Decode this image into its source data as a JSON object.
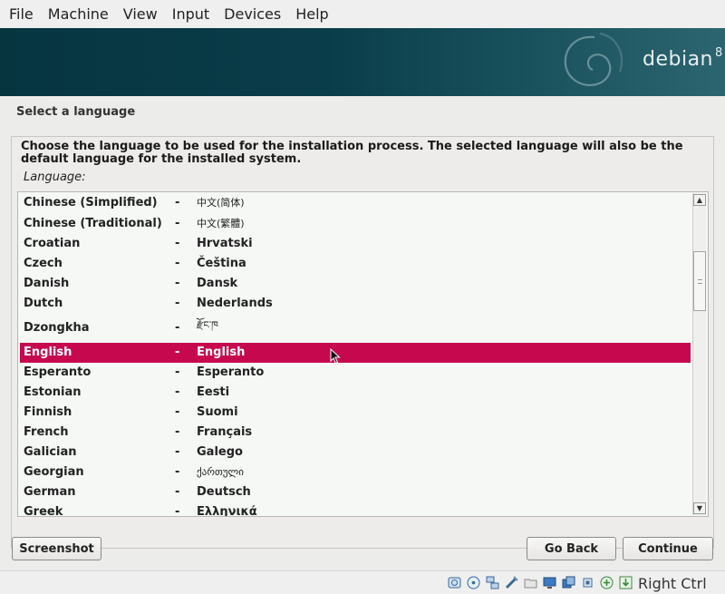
{
  "menubar": {
    "items": [
      "File",
      "Machine",
      "View",
      "Input",
      "Devices",
      "Help"
    ]
  },
  "banner": {
    "brand": "debian",
    "version": "8"
  },
  "page_title": "Select a language",
  "description": "Choose the language to be used for the installation process. The selected language will also be the default language for the installed system.",
  "field_label": "Language:",
  "languages": [
    {
      "name": "Chinese (Simplified)",
      "native": "中文(简体)"
    },
    {
      "name": "Chinese (Traditional)",
      "native": "中文(繁體)"
    },
    {
      "name": "Croatian",
      "native": "Hrvatski"
    },
    {
      "name": "Czech",
      "native": "Čeština"
    },
    {
      "name": "Danish",
      "native": "Dansk"
    },
    {
      "name": "Dutch",
      "native": "Nederlands"
    },
    {
      "name": "Dzongkha",
      "native": "རྫོང་ཁ"
    },
    {
      "name": "English",
      "native": "English"
    },
    {
      "name": "Esperanto",
      "native": "Esperanto"
    },
    {
      "name": "Estonian",
      "native": "Eesti"
    },
    {
      "name": "Finnish",
      "native": "Suomi"
    },
    {
      "name": "French",
      "native": "Français"
    },
    {
      "name": "Galician",
      "native": "Galego"
    },
    {
      "name": "Georgian",
      "native": "ქართული"
    },
    {
      "name": "German",
      "native": "Deutsch"
    },
    {
      "name": "Greek",
      "native": "Ελληνικά"
    }
  ],
  "separator": "-",
  "selected_language": "English",
  "buttons": {
    "screenshot": "Screenshot",
    "go_back": "Go Back",
    "continue": "Continue"
  },
  "statusbar": {
    "icons": [
      "hard-disk-icon",
      "optical-drive-icon",
      "network-icon",
      "usb-icon",
      "shared-folder-icon",
      "display-icon",
      "video-capture-icon",
      "cpu-icon",
      "mouse-integration-icon",
      "keyboard-icon"
    ],
    "host_key": "Right Ctrl"
  },
  "colors": {
    "selection": "#c6094f",
    "banner": "#0a3d4a"
  }
}
